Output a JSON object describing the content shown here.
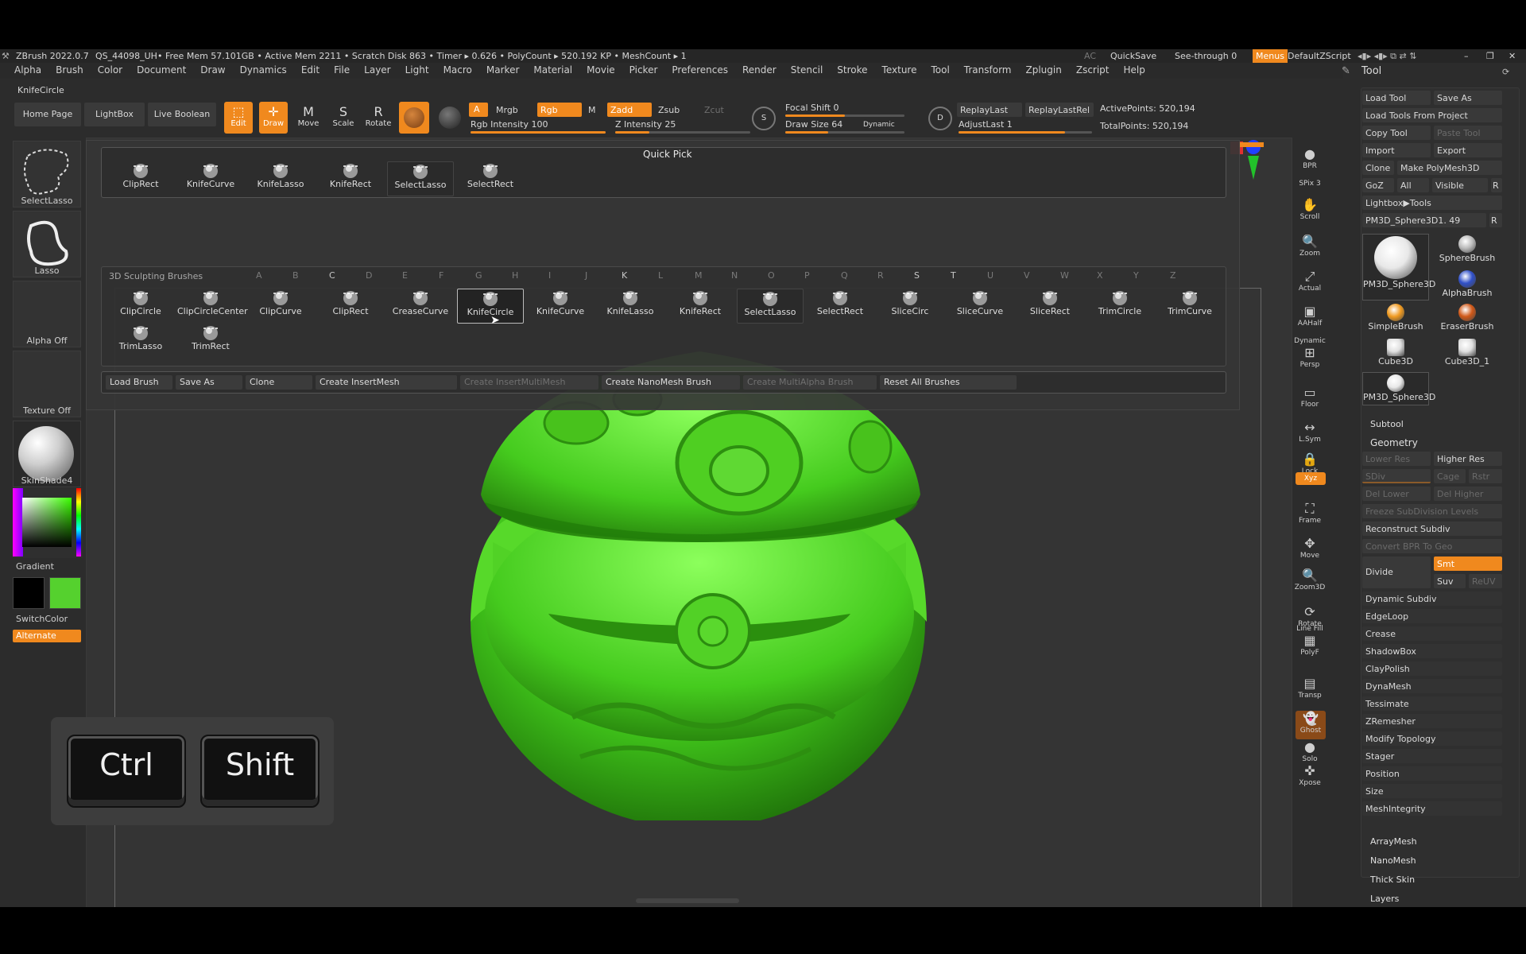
{
  "titlebar": {
    "app": "ZBrush 2022.0.7",
    "project": "QS_44098_UH",
    "stats": "• Free Mem 57.101GB • Active Mem 2211 • Scratch Disk 863 • Timer ▸ 0.626 • PolyCount ▸ 520.192 KP • MeshCount ▸ 1",
    "ac": "AC",
    "quicksave": "QuickSave",
    "seethrough": "See-through",
    "seethrough_value": "0",
    "menus": "Menus",
    "script": "DefaultZScript"
  },
  "menubar": [
    "Alpha",
    "Brush",
    "Color",
    "Document",
    "Draw",
    "Dynamics",
    "Edit",
    "File",
    "Layer",
    "Light",
    "Macro",
    "Marker",
    "Material",
    "Movie",
    "Picker",
    "Preferences",
    "Render",
    "Stencil",
    "Stroke",
    "Texture",
    "Tool",
    "Transform",
    "Zplugin",
    "Zscript",
    "Help"
  ],
  "current_brush": "KnifeCircle",
  "toolbar": {
    "home_page": "Home Page",
    "lightbox": "LightBox",
    "live_boolean": "Live Boolean",
    "edit": "Edit",
    "draw": "Draw",
    "move": "Move",
    "scale": "Scale",
    "rotate": "Rotate",
    "a": "A",
    "mrgb": "Mrgb",
    "rgb": "Rgb",
    "m": "M",
    "zadd": "Zadd",
    "zsub": "Zsub",
    "zcut": "Zcut",
    "rgb_intensity": "Rgb Intensity 100",
    "z_intensity": "Z Intensity 25",
    "focal_shift": "Focal Shift 0",
    "draw_size": "Draw Size 64",
    "dynamic": "Dynamic",
    "replay_last": "ReplayLast",
    "replay_last_rel": "ReplayLastRel",
    "adjust_last": "AdjustLast 1",
    "active_points": "ActivePoints: 520,194",
    "total_points": "TotalPoints: 520,194",
    "s": "S",
    "d": "D",
    "rgb_intensity_level": 1.0,
    "z_intensity_level": 0.25
  },
  "left_shelf": {
    "stroke": "SelectLasso",
    "alpha_lasso": "Lasso",
    "alpha": "Alpha Off",
    "texture": "Texture Off",
    "material": "SkinShade4",
    "gradient": "Gradient",
    "switchcolor": "SwitchColor",
    "alternate": "Alternate",
    "main_color": "#55d12e",
    "secondary_color": "#000000"
  },
  "quick_pick": {
    "title": "Quick Pick",
    "items": [
      "ClipRect",
      "KnifeCurve",
      "KnifeLasso",
      "KnifeRect",
      "SelectLasso",
      "SelectRect"
    ],
    "selected": "SelectLasso"
  },
  "brushes": {
    "title": "3D Sculpting Brushes",
    "letters": [
      "A",
      "B",
      "C",
      "D",
      "E",
      "F",
      "G",
      "H",
      "I",
      "J",
      "K",
      "L",
      "M",
      "N",
      "O",
      "P",
      "Q",
      "R",
      "S",
      "T",
      "U",
      "V",
      "W",
      "X",
      "Y",
      "Z"
    ],
    "active_letters": [
      "C",
      "K",
      "S",
      "T"
    ],
    "row1": [
      "ClipCircle",
      "ClipCircleCenter",
      "ClipCurve",
      "ClipRect",
      "CreaseCurve",
      "KnifeCircle",
      "KnifeCurve",
      "KnifeLasso",
      "KnifeRect",
      "SelectLasso",
      "SelectRect",
      "SliceCirc",
      "SliceCurve",
      "SliceRect",
      "TrimCircle",
      "TrimCurve"
    ],
    "row2": [
      "TrimLasso",
      "TrimRect"
    ],
    "selected": "KnifeCircle",
    "active": "SelectLasso"
  },
  "brush_actions": [
    "Load Brush",
    "Save As",
    "Clone",
    "Create InsertMesh",
    "Create InsertMultiMesh",
    "Create NanoMesh Brush",
    "Create MultiAlpha Brush",
    "Reset All Brushes"
  ],
  "right_toolbar": [
    "BPR",
    "SPix 3",
    "Scroll",
    "Zoom",
    "Actual",
    "AAHalf",
    "Dynamic",
    "Persp",
    "Floor",
    "L.Sym",
    "Lock",
    "Xyz",
    "Frame",
    "Move",
    "Zoom3D",
    "Rotate",
    "Line Fill",
    "PolyF",
    "Transp",
    "Ghost",
    "Solo",
    "Xpose"
  ],
  "tool_palette": {
    "title": "Tool",
    "load_tool": "Load Tool",
    "save_as": "Save As",
    "load_from_project": "Load Tools From Project",
    "copy_tool": "Copy Tool",
    "paste_tool": "Paste Tool",
    "import": "Import",
    "export": "Export",
    "clone": "Clone",
    "make_polymesh": "Make PolyMesh3D",
    "goz": "GoZ",
    "all": "All",
    "visible": "Visible",
    "r": "R",
    "lightbox_tools": "Lightbox▶Tools",
    "current_tool": "PM3D_Sphere3D1. 49",
    "thumbs": [
      "PM3D_Sphere3D",
      "SphereBrush",
      "AlphaBrush",
      "SimpleBrush",
      "EraserBrush",
      "Cube3D",
      "Cube3D_1",
      "PM3D_Sphere3D"
    ],
    "subtool": "Subtool",
    "geometry": "Geometry",
    "lower_res": "Lower Res",
    "higher_res": "Higher Res",
    "sdiv": "SDiv",
    "cage": "Cage",
    "rstr": "Rstr",
    "del_lower": "Del Lower",
    "del_higher": "Del Higher",
    "freeze": "Freeze SubDivision Levels",
    "reconstruct": "Reconstruct Subdiv",
    "convert_bpr": "Convert BPR To Geo",
    "divide": "Divide",
    "smt": "Smt",
    "suv": "Suv",
    "reuv": "ReUV",
    "geometry_items": [
      "Dynamic Subdiv",
      "EdgeLoop",
      "Crease",
      "ShadowBox",
      "ClayPolish",
      "DynaMesh",
      "Tessimate",
      "ZRemesher",
      "Modify Topology",
      "Stager",
      "Position",
      "Size",
      "MeshIntegrity"
    ],
    "sections": [
      "ArrayMesh",
      "NanoMesh",
      "Thick Skin",
      "Layers"
    ]
  },
  "keys": [
    "Ctrl",
    "Shift"
  ]
}
